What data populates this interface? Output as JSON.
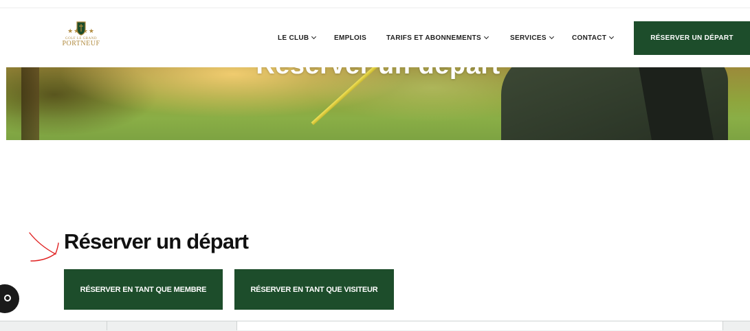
{
  "logo": {
    "stars": "★★ ★★",
    "line1": "GOLF LE GRAND",
    "line2": "PORTNEUF",
    "gold": "#b08a3e"
  },
  "nav": {
    "items": [
      {
        "label": "LE CLUB",
        "dropdown": true
      },
      {
        "label": "EMPLOIS",
        "dropdown": false
      },
      {
        "label": "TARIFS ET ABONNEMENTS",
        "dropdown": true
      },
      {
        "label": "SERVICES",
        "dropdown": true
      },
      {
        "label": "CONTACT",
        "dropdown": true
      }
    ],
    "cta_label": "RÉSERVER UN DÉPART"
  },
  "hero": {
    "title": "Réserver un départ"
  },
  "main": {
    "heading": "Réserver un départ",
    "member_button": "RÉSERVER EN TANT QUE MEMBRE",
    "visitor_button": "RÉSERVER EN TANT QUE VISITEUR"
  },
  "colors": {
    "brand_green": "#1d4d2b",
    "annotation_red": "#e02020"
  }
}
